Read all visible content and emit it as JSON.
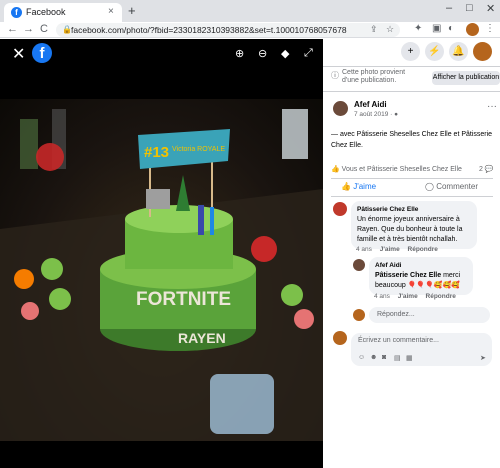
{
  "browser": {
    "tab_title": "Facebook",
    "tab_close": "×",
    "new_tab": "+",
    "min": "–",
    "max": "□",
    "close": "✕",
    "back": "←",
    "forward": "→",
    "reload": "C",
    "url": "facebook.com/photo/?fbid=2330182310393882&set=t.100010768057678"
  },
  "viewer": {
    "close": "✕",
    "logo": "f",
    "zoom_in": "⊕",
    "zoom_out": "⊖",
    "tag": "◆",
    "fullscreen": "⤢"
  },
  "cake": {
    "topper_number": "#13",
    "topper_name": "Victoria ROYALE",
    "banner": "FORTNITE",
    "name": "RAYEN"
  },
  "header_icons": {
    "create": "+",
    "messenger": "⚡",
    "notifications": "🔔"
  },
  "publication_note": {
    "text": "Cette photo provient d'une publication.",
    "button": "Afficher la publication"
  },
  "post": {
    "author": "Afef Aidi",
    "date": "7 août 2019 · ",
    "more": "···",
    "text": "— avec Pâtisserie Sheselles Chez Elle et Pâtisserie Chez Elle.",
    "reactions_label": "Vous et Pâtisserie Sheselles Chez Elle",
    "comment_count": "2",
    "like_label": "J'aime",
    "comment_label": "Commenter"
  },
  "comments": [
    {
      "author": "Pâtisserie Chez Elle",
      "text": "Un énorme joyeux anniversaire à Rayen. Que du bonheur à toute la famille et à très bientôt nchallah.",
      "time": "4 ans",
      "like": "J'aime",
      "reply": "Répondre"
    },
    {
      "author": "Afef Aidi",
      "mention": "Pâtisserie Chez Elle",
      "text": " merci beaucoup 🎈🎈🎈🥰🥰🥰",
      "time": "4 ans",
      "like": "J'aime",
      "reply": "Répondre"
    }
  ],
  "reply_placeholder": "Répondez...",
  "comment_placeholder": "Écrivez un commentaire...",
  "colors": {
    "facebook_blue": "#1877f2",
    "bubble_bg": "#f0f2f5",
    "photo_bg": "#000000"
  }
}
